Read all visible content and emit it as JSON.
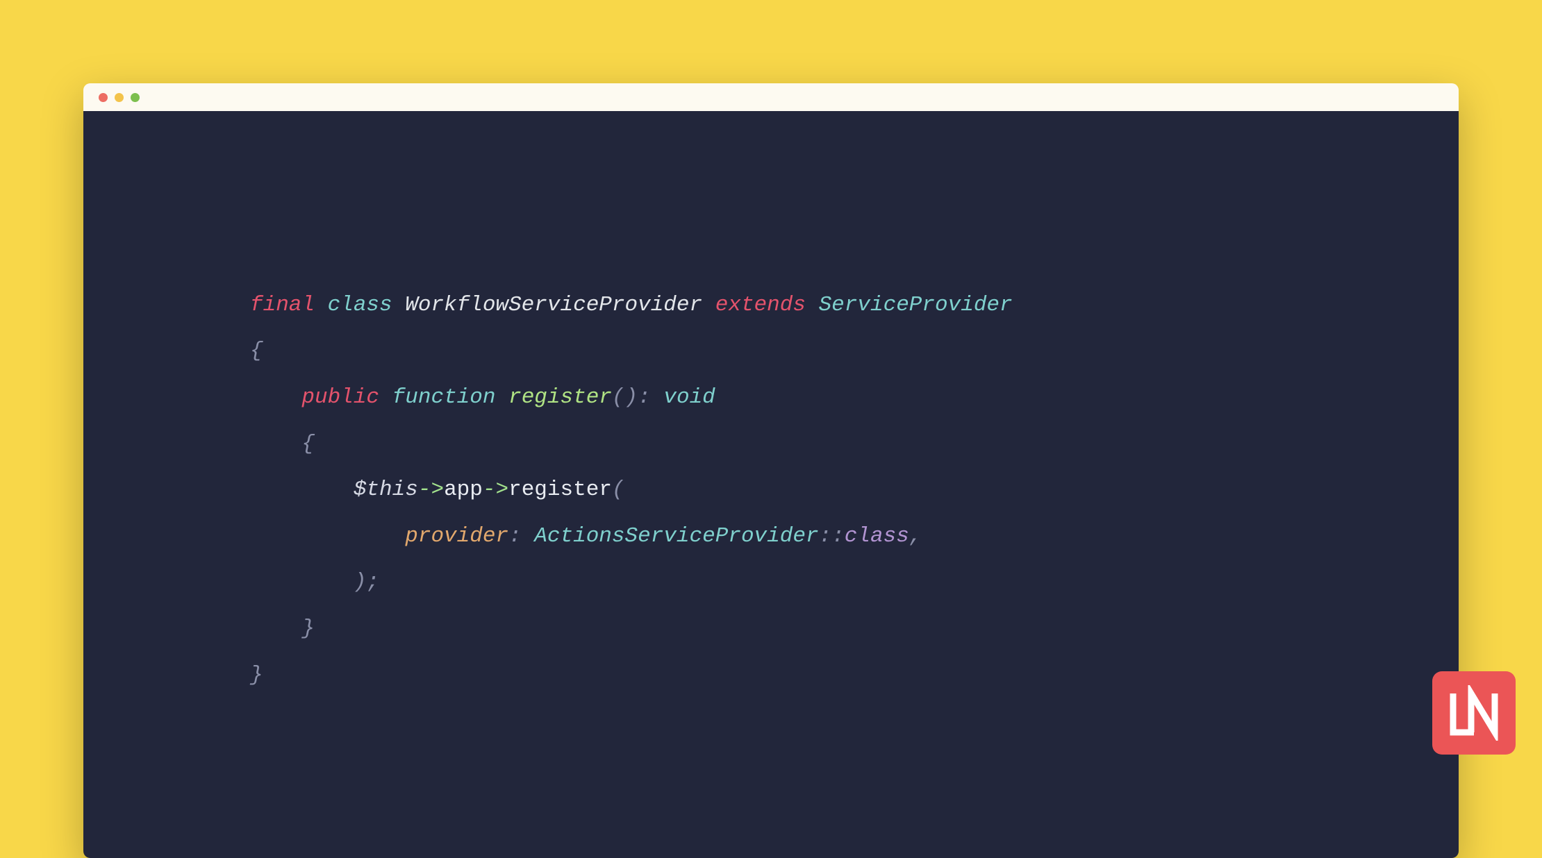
{
  "colors": {
    "background": "#f8d749",
    "editor_bg": "#22263b",
    "titlebar_bg": "#fdfaf1",
    "dot_red": "#ed6d63",
    "dot_yellow": "#f3c34a",
    "dot_green": "#7dbf4e",
    "logo_bg": "#eb5556"
  },
  "code": {
    "line1": {
      "final": "final",
      "class": "class",
      "name": "WorkflowServiceProvider",
      "extends": "extends",
      "parent": "ServiceProvider"
    },
    "line2": {
      "brace": "{"
    },
    "line3": {
      "indent": "    ",
      "public": "public",
      "function": "function",
      "name": "register",
      "parens": "()",
      "colon": ":",
      "void": "void"
    },
    "line4": {
      "indent": "    ",
      "brace": "{"
    },
    "line5": {
      "indent": "        ",
      "this": "$this",
      "arrow1": "->",
      "app": "app",
      "arrow2": "->",
      "register": "register",
      "paren": "("
    },
    "line6": {
      "indent": "            ",
      "named": "provider",
      "colon": ":",
      "ref": "ActionsServiceProvider",
      "dcolon": "::",
      "classlit": "class",
      "comma": ","
    },
    "line7": {
      "indent": "        ",
      "paren": ")",
      "semi": ";"
    },
    "line8": {
      "indent": "    ",
      "brace": "}"
    },
    "line9": {
      "brace": "}"
    }
  },
  "logo": {
    "text": "LN"
  }
}
